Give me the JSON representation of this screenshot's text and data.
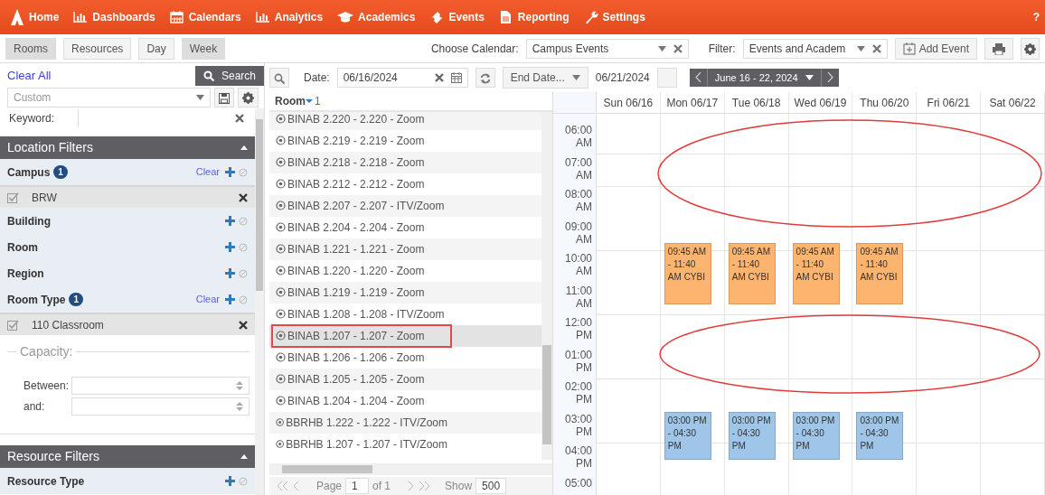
{
  "nav": {
    "items": [
      {
        "label": "Home",
        "kind": "home"
      },
      {
        "label": "Dashboards",
        "kind": "chart"
      },
      {
        "label": "Calendars",
        "kind": "calendar"
      },
      {
        "label": "Analytics",
        "kind": "chart"
      },
      {
        "label": "Academics",
        "kind": "cap"
      },
      {
        "label": "Events",
        "kind": "ticket"
      },
      {
        "label": "Reporting",
        "kind": "document"
      },
      {
        "label": "Settings",
        "kind": "wrench"
      }
    ],
    "help": "?"
  },
  "toolbar": {
    "view_buttons": [
      {
        "label": "Rooms",
        "selected": true
      },
      {
        "label": "Resources",
        "selected": false
      },
      {
        "label": "Day",
        "selected": false
      },
      {
        "label": "Week",
        "selected": true
      }
    ],
    "calendar_label": "Choose Calendar:",
    "calendar_value": "Campus Events",
    "filter_label": "Filter:",
    "filter_value": "Events and Academ",
    "add_event": "Add Event"
  },
  "sidebar": {
    "clear_all": "Clear All",
    "search": "Search",
    "preset": {
      "placeholder": "Custom"
    },
    "keyword_label": "Keyword:",
    "sections": [
      {
        "title": "Location Filters",
        "expanded": true,
        "filters": [
          {
            "label": "Campus",
            "count": "1",
            "clear": "Clear",
            "chips": [
              "BRW"
            ]
          },
          {
            "label": "Building"
          },
          {
            "label": "Room"
          },
          {
            "label": "Region"
          },
          {
            "label": "Room Type",
            "count": "1",
            "clear": "Clear",
            "chips": [
              "110 Classroom"
            ]
          }
        ],
        "capacity": {
          "legend": "Capacity:",
          "between": "Between:",
          "and": "and:"
        }
      },
      {
        "title": "Resource Filters",
        "expanded": true,
        "filters": [
          {
            "label": "Resource Type"
          }
        ]
      }
    ]
  },
  "date_bar": {
    "date_label": "Date:",
    "date": "06/16/2024",
    "end_mode": "End Date...",
    "end_date": "06/21/2024",
    "range": "June 16 - 22, 2024"
  },
  "rooms": {
    "column": "Room",
    "sort_order": "1",
    "rows": [
      {
        "name": "BINAB 2.220 - 2.220 - Zoom",
        "selected": false,
        "outlined": false
      },
      {
        "name": "BINAB 2.219 - 2.219 - Zoom",
        "selected": false,
        "outlined": false
      },
      {
        "name": "BINAB 2.218 - 2.218 - Zoom",
        "selected": false,
        "outlined": false
      },
      {
        "name": "BINAB 2.212 - 2.212 - Zoom",
        "selected": false,
        "outlined": false
      },
      {
        "name": "BINAB 2.207 - 2.207 - ITV/Zoom",
        "selected": false,
        "outlined": false
      },
      {
        "name": "BINAB 2.204 - 2.204 - Zoom",
        "selected": false,
        "outlined": false
      },
      {
        "name": "BINAB 1.221 - 1.221 - Zoom",
        "selected": false,
        "outlined": false
      },
      {
        "name": "BINAB 1.220 - 1.220 - Zoom",
        "selected": false,
        "outlined": false
      },
      {
        "name": "BINAB 1.219 - 1.219 - Zoom",
        "selected": false,
        "outlined": false
      },
      {
        "name": "BINAB 1.208 - 1.208 - ITV/Zoom",
        "selected": false,
        "outlined": false
      },
      {
        "name": "BINAB 1.207 - 1.207 - Zoom",
        "selected": true,
        "outlined": true
      },
      {
        "name": "BINAB 1.206 - 1.206 - Zoom",
        "selected": false,
        "outlined": false
      },
      {
        "name": "BINAB 1.205 - 1.205 - Zoom",
        "selected": false,
        "outlined": false
      },
      {
        "name": "BINAB 1.204 - 1.204 - Zoom",
        "selected": false,
        "outlined": false
      },
      {
        "name": "BBRHB 1.222 - 1.222 - ITV/Zoom",
        "selected": false,
        "outlined": false
      },
      {
        "name": "BBRHB 1.207 - 1.207 - ITV/Zoom",
        "selected": false,
        "outlined": false
      }
    ],
    "pager": {
      "page_label": "Page",
      "page": "1",
      "of": "of 1",
      "show_label": "Show",
      "show": "500"
    }
  },
  "calendar": {
    "days": [
      {
        "label": "Sun 06/16"
      },
      {
        "label": "Mon 06/17",
        "events": [
          {
            "text": "09:45 AM - 11:40 AM CYBI",
            "color": "#fdb46e"
          },
          {
            "text": "03:00 PM - 04:30 PM",
            "color": "#9fc5e8"
          }
        ]
      },
      {
        "label": "Tue 06/18",
        "events": [
          {
            "text": "09:45 AM - 11:40 AM CYBI",
            "color": "#fdb46e"
          },
          {
            "text": "03:00 PM - 04:30 PM",
            "color": "#9fc5e8"
          }
        ]
      },
      {
        "label": "Wed 06/19",
        "events": [
          {
            "text": "09:45 AM - 11:40 AM CYBI",
            "color": "#fdb46e"
          },
          {
            "text": "03:00 PM - 04:30 PM",
            "color": "#9fc5e8"
          }
        ]
      },
      {
        "label": "Thu 06/20",
        "events": [
          {
            "text": "09:45 AM - 11:40 AM CYBI",
            "color": "#fdb46e"
          },
          {
            "text": "03:00 PM - 04:30 PM",
            "color": "#9fc5e8"
          }
        ]
      },
      {
        "label": "Fri 06/21"
      },
      {
        "label": "Sat 06/22"
      }
    ],
    "times": [
      "06:00 AM",
      "07:00 AM",
      "08:00 AM",
      "09:00 AM",
      "10:00 AM",
      "11:00 AM",
      "12:00 PM",
      "01:00 PM",
      "02:00 PM",
      "03:00 PM",
      "04:00 PM",
      "05:00"
    ]
  }
}
